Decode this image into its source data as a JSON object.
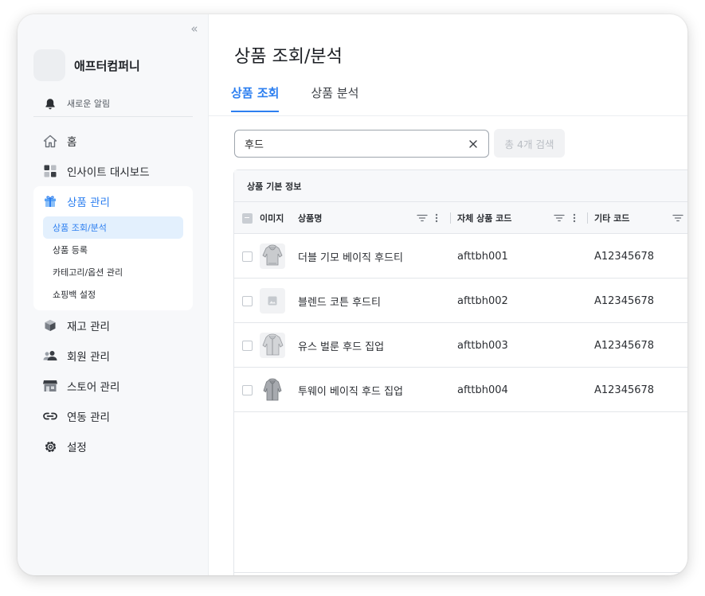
{
  "sidebar": {
    "company_name": "애프터컴퍼니",
    "notification_label": "새로운 알림",
    "nav": {
      "home": "홈",
      "insight_dashboard": "인사이트 대시보드",
      "product_management": "상품 관리",
      "inventory_management": "재고 관리",
      "member_management": "회원 관리",
      "store_management": "스토어 관리",
      "integration_management": "연동 관리",
      "settings": "설정"
    },
    "product_submenu": [
      "상품 조회/분석",
      "상품 등록",
      "카테고리/옵션 관리",
      "쇼핑백 설정"
    ],
    "active_submenu": "상품 조회/분석"
  },
  "main": {
    "title": "상품 조회/분석",
    "tabs": [
      "상품 조회",
      "상품 분석"
    ],
    "active_tab": "상품 조회",
    "search": {
      "value": "후드",
      "button_label": "총 4개 검색"
    },
    "table": {
      "group_header": "상품 기본 정보",
      "columns": [
        "이미지",
        "상품명",
        "자체 상품 코드",
        "기타 코드"
      ],
      "rows": [
        {
          "name": "더블 기모 베이직 후드티",
          "code": "afttbh001",
          "other_code": "A12345678",
          "image": "hoodie-gray"
        },
        {
          "name": "블렌드 코튼 후드티",
          "code": "afttbh002",
          "other_code": "A12345678",
          "image": "placeholder"
        },
        {
          "name": "유스 벌룬 후드 집업",
          "code": "afttbh003",
          "other_code": "A12345678",
          "image": "zip-hoodie-light"
        },
        {
          "name": "투웨이 베이직 후드 집업",
          "code": "afttbh004",
          "other_code": "A12345678",
          "image": "zip-hoodie-gray"
        }
      ]
    }
  },
  "colors": {
    "accent": "#2d7ff0",
    "active_submenu_bg": "#e3f0fd",
    "sidebar_bg": "#f7f8fa"
  }
}
